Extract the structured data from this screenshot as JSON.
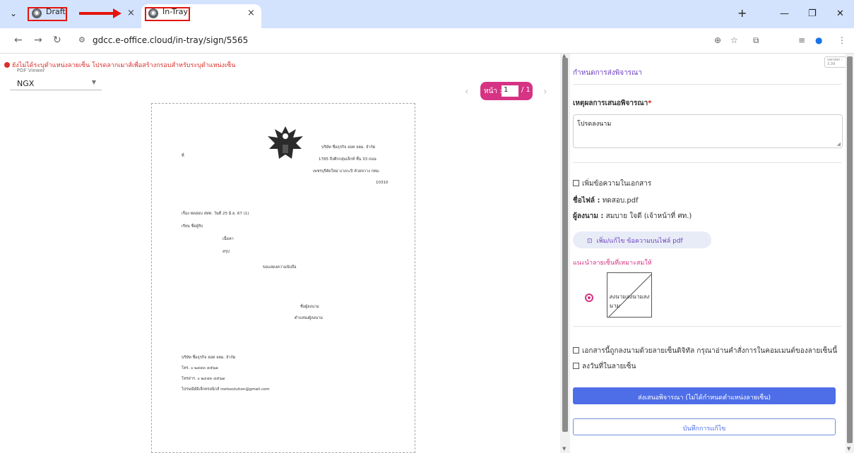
{
  "browser": {
    "tabs": [
      {
        "title": "Draft"
      },
      {
        "title": "In-Tray"
      }
    ],
    "new_tab": "+",
    "url": "gdcc.e-office.cloud/in-tray/sign/5565"
  },
  "left": {
    "warning": "ยังไม่ได้ระบุตำแหน่งลายเซ็น โปรดลากเมาส์เพื่อสร้างกรอบสำหรับระบุตำแหน่งเซ็น",
    "viewer_label": "PDF Viewer",
    "viewer_value": "NGX",
    "pager": {
      "label": "หน้า :",
      "current": "1",
      "total": "/ 1"
    }
  },
  "document": {
    "to_label": "ที่",
    "company_name": "บริษัท ชื่อธุรกิจ ลอท จตม. จำกัด",
    "address1": "1785 ถึงตึกกลุ่มเล็กท์ ชั้น 33 ถนน",
    "address2": "เพชรบุรีตัดใหม่ บางกะปิ ห้วยขวาง กทม.",
    "postcode": "10310",
    "subject": "เรื่อง ทดสอบ สทท. วันที่ 25 มิ.ย. 67 (1)",
    "salutation": "เรียน ชื่อผู้รับ",
    "body1": "เนื้อหา",
    "body2": "สรุป",
    "closing": "ขอแสดงความนับถือ",
    "signer_name": "ชื่อผู้ลงนาม",
    "signer_position": "ตำแหน่งผู้ลงนาม",
    "footer1": "บริษัท ชื่อธุรกิจ ลอท จตม. จำกัด",
    "footer2": "โทร. ๐ ๒๔๔๓ ๔๕๖๗",
    "footer3": "โทรสาร. ๐ ๒๔๔๓ ๔๕๖๗",
    "footer4": "ไปรษณีย์อิเล็กทรอนิกส์ inetssolution@gmail.com"
  },
  "right": {
    "version": "version : 3.39",
    "heading": "กำหนดการส่งพิจารณา",
    "reason_label": "เหตุผลการเสนอพิจารณา",
    "required_mark": "*",
    "reason_value": "โปรดลงนาม",
    "add_text_label": "เพิ่มข้อความในเอกสาร",
    "file_label": "ชื่อไฟล์ :",
    "file_value": "ทดสอบ.pdf",
    "signer_label": "ผู้ลงนาม :",
    "signer_value": "สมบาย ใจดี (เจ้าหน้าที่ ศท.)",
    "pdf_button": "เพิ่ม/แก้ไข ข้อความบนไฟล์ pdf",
    "suggest_label": "แนะนำลายเซ็นที่เหมาะสมให้",
    "signature_text": "ลงนามลงนามลงนาม",
    "digital_sig_check": "เอกสารนี้ถูกลงนามด้วยลายเซ็นดิจิทัล กรุณาอ่านคำสั่งการในคอมเมนต์ของลายเซ็นนี้",
    "date_check": "ลงวันที่ในลายเซ็น",
    "submit_button": "ส่งเสนอพิจารณา (ไม่ได้กำหนดตำแหน่งลายเซ็น)",
    "save_button": "บันทึกการแก้ไข"
  },
  "colors": {
    "accent": "#d63384",
    "heading_purple": "#6f42c1",
    "primary_blue": "#4e6ee8",
    "annotation_red": "#e3140c",
    "tabstrip": "#d3e3fd"
  }
}
